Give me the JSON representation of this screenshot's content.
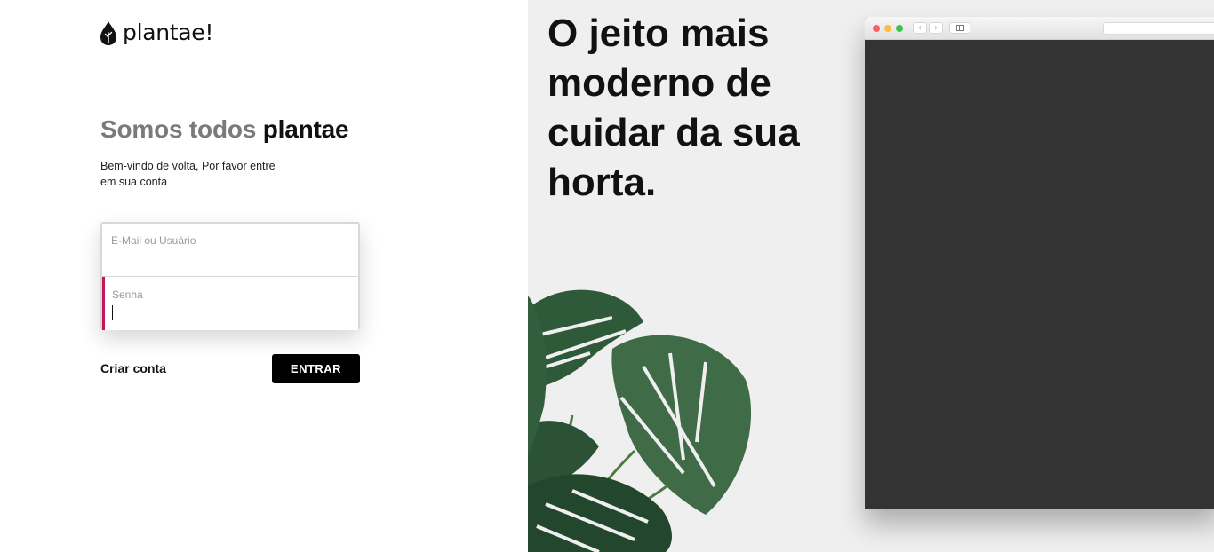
{
  "brand": {
    "name": "plantae!",
    "logo_icon": "leaf-drop-icon"
  },
  "login": {
    "heading_muted": "Somos todos",
    "heading_bold": "plantae",
    "subtitle_line1": "Bem-vindo de volta, Por favor entre",
    "subtitle_line2": "em sua conta",
    "email_label": "E-Mail ou Usuário",
    "email_value": "",
    "password_label": "Senha",
    "password_value": "",
    "create_account_label": "Criar conta",
    "submit_label": "ENTRAR"
  },
  "hero": {
    "tagline_line1": "O jeito mais",
    "tagline_line2": "moderno de",
    "tagline_line3": "cuidar da sua",
    "tagline_line4": "horta."
  },
  "colors": {
    "accent_focus": "#c2185b",
    "button_bg": "#000000",
    "hero_bg": "#efefef",
    "browser_content": "#333333"
  }
}
